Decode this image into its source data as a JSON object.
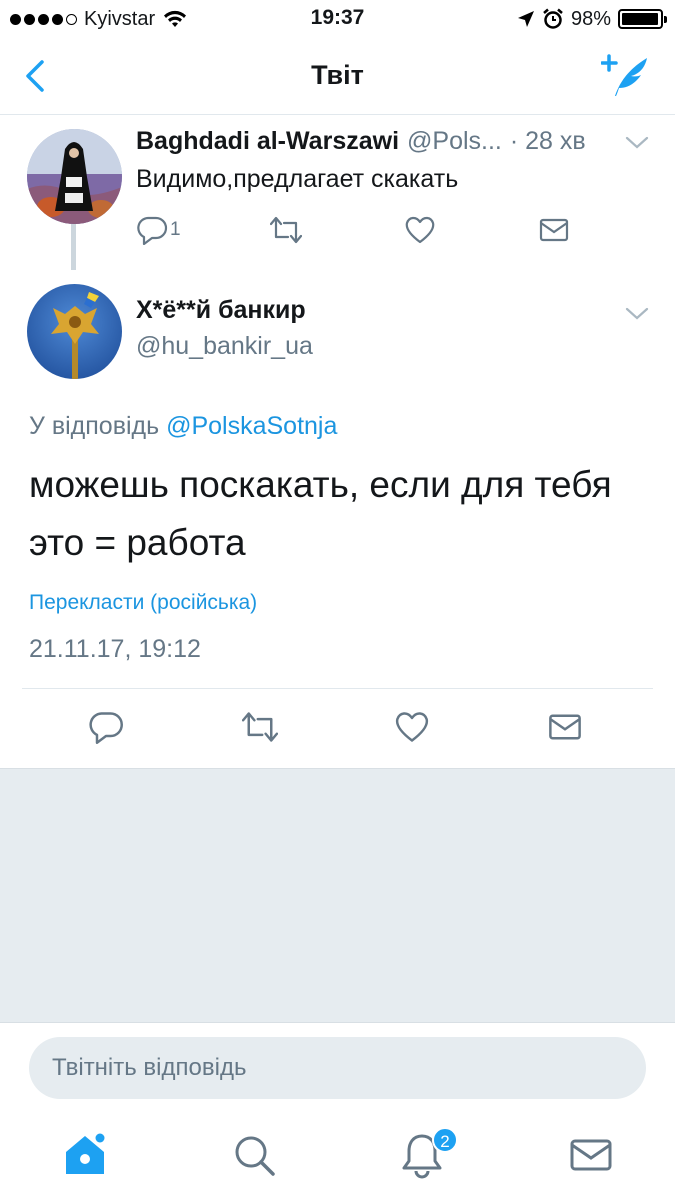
{
  "status_bar": {
    "carrier": "Kyivstar",
    "time": "19:37",
    "battery": "98%",
    "battery_level": 0.98
  },
  "nav": {
    "title": "Твіт",
    "back_icon": "chevron-left-icon",
    "compose_icon": "compose-tweet-icon"
  },
  "parent_tweet": {
    "author_name": "Baghdadi al-Warszawi",
    "author_handle": "@Pols...",
    "time": "· 28 хв",
    "text": "Видимо,предлагает скакать",
    "reply_count": "1"
  },
  "main_tweet": {
    "author_name": "Х*ё**й банкир",
    "author_handle": "@hu_bankir_ua",
    "reply_to_label": "У відповідь",
    "reply_to_mention": "@PolskaSotnja",
    "text": "можешь поскакать, если для тебя это = работа",
    "translate_label": "Перекласти (російська)",
    "date": "21.11.17, 19:12"
  },
  "composer": {
    "placeholder": "Твітніть відповідь"
  },
  "tabbar": {
    "notifications_badge": "2"
  },
  "colors": {
    "accent": "#1da1f2",
    "link": "#1b95e0",
    "secondary_text": "#657786",
    "divider": "#e1e8ed",
    "background_gray": "#e6ecf0"
  }
}
